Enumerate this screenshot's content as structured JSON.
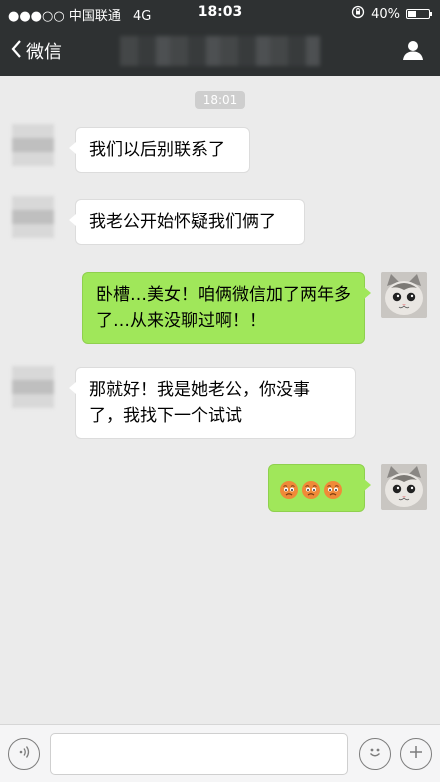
{
  "status_bar": {
    "carrier": "●●●○○ 中国联通",
    "network": "4G",
    "time": "18:03",
    "battery": "40%",
    "battery_level": 0.4
  },
  "nav": {
    "back_label": "微信"
  },
  "timestamp": "18:01",
  "messages": [
    {
      "side": "left",
      "text": "我们以后别联系了"
    },
    {
      "side": "left",
      "text": "我老公开始怀疑我们俩了"
    },
    {
      "side": "right",
      "text": "卧槽…美女！咱俩微信加了两年多了…从来没聊过啊！！"
    },
    {
      "side": "left",
      "text": "那就好！我是她老公，你没事了，我找下一个试试"
    },
    {
      "side": "right",
      "emoji": [
        "worried-face",
        "worried-face",
        "worried-face"
      ]
    }
  ],
  "colors": {
    "nav_bg": "#2e3132",
    "chat_bg": "#ebebeb",
    "sent_bubble": "#a0e75a",
    "received_bubble": "#ffffff"
  }
}
